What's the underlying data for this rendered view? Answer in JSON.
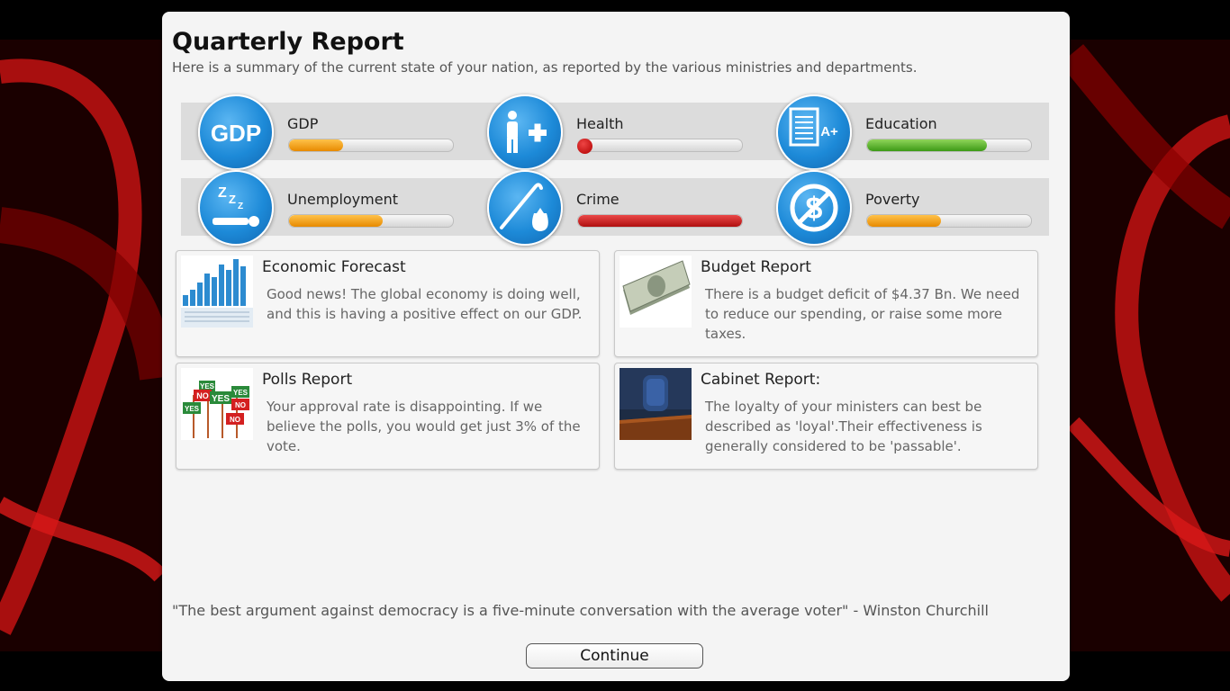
{
  "header": {
    "title": "Quarterly Report",
    "subtitle": "Here is a summary of the current state of your nation, as reported by the various ministries and departments."
  },
  "stats": [
    {
      "label": "GDP",
      "level": 0.33,
      "color": "#f29a00",
      "icon": "gdp-icon"
    },
    {
      "label": "Health",
      "level": 0.05,
      "color": "#c81414",
      "icon": "health-icon"
    },
    {
      "label": "Education",
      "level": 0.73,
      "color": "#4aa820",
      "icon": "education-icon"
    },
    {
      "label": "Unemployment",
      "level": 0.57,
      "color": "#f29a00",
      "icon": "sleeping-person-icon"
    },
    {
      "label": "Crime",
      "level": 1.0,
      "color": "#c81414",
      "icon": "crowbar-bag-icon"
    },
    {
      "label": "Poverty",
      "level": 0.45,
      "color": "#f29a00",
      "icon": "no-dollar-icon"
    }
  ],
  "gdp_icon_text": "GDP",
  "education_icon_text": "A+",
  "cards": [
    {
      "title": "Economic Forecast",
      "body": "Good news! The global economy is doing well, and this is having a positive effect on our GDP.",
      "thumb": "bar-chart-thumbnail"
    },
    {
      "title": "Budget Report",
      "body": "There is a budget deficit of $4.37 Bn. We need to reduce our spending, or raise some more taxes.",
      "thumb": "money-stack-thumbnail"
    },
    {
      "title": "Polls Report",
      "body": "Your approval rate is disappointing. If we believe the polls, you would get just 3% of the vote.",
      "thumb": "poll-signs-thumbnail"
    },
    {
      "title": "Cabinet Report:",
      "body": "The loyalty of your ministers can best be described as 'loyal'.Their effectiveness is generally considered to be 'passable'.",
      "thumb": "cabinet-chair-thumbnail"
    }
  ],
  "poll_signs": [
    "YES",
    "NO",
    "YES",
    "YES",
    "NO",
    "YES",
    "NO"
  ],
  "quote": "\"The best argument against democracy is a five-minute conversation with the average voter\" - Winston Churchill",
  "continue_label": "Continue",
  "colors": {
    "accent_blue": "#1d8ad8",
    "background_red": "#c01010",
    "panel": "#f4f4f4"
  }
}
